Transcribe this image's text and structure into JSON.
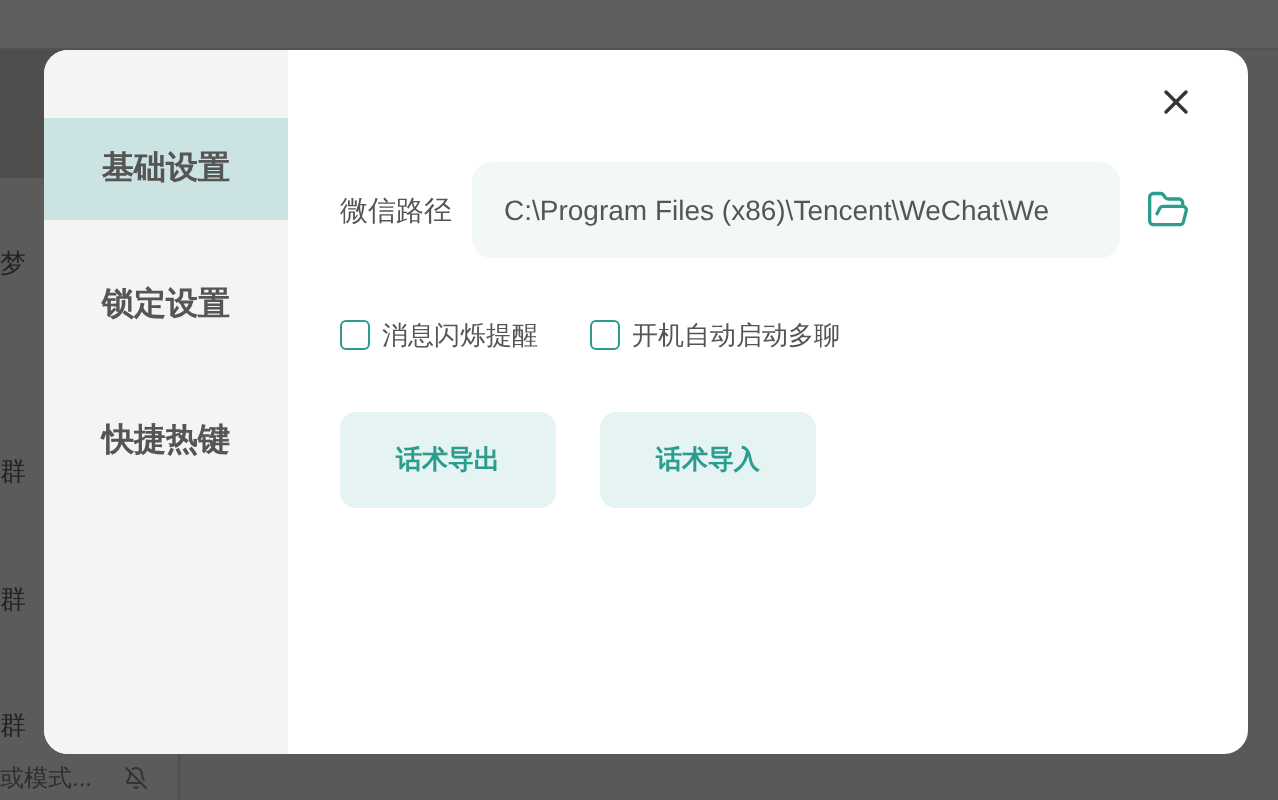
{
  "background": {
    "texts": [
      "梦",
      "群",
      "群",
      "群"
    ],
    "preview": "或模式..."
  },
  "dialog": {
    "sidebar": {
      "items": [
        {
          "label": "基础设置",
          "selected": true
        },
        {
          "label": "锁定设置",
          "selected": false
        },
        {
          "label": "快捷热键",
          "selected": false
        }
      ]
    },
    "path": {
      "label": "微信路径",
      "value": "C:\\Program Files (x86)\\Tencent\\WeChat\\We"
    },
    "checkboxes": [
      {
        "label": "消息闪烁提醒",
        "checked": false
      },
      {
        "label": "开机自动启动多聊",
        "checked": false
      }
    ],
    "buttons": [
      "话术导出",
      "话术导入"
    ]
  }
}
